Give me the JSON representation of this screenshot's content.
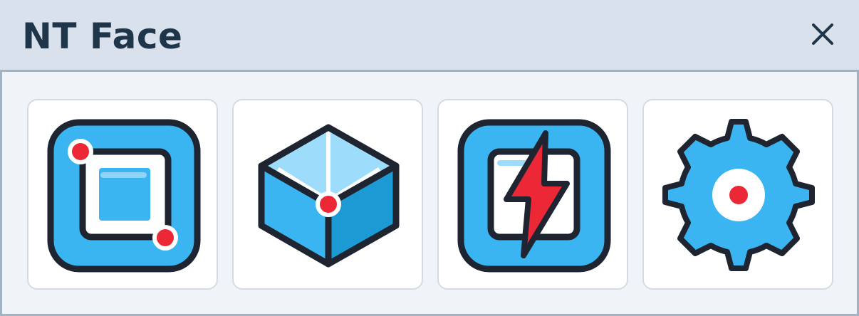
{
  "window": {
    "title": "NT Face",
    "close_icon": "close-icon"
  },
  "toolbar": {
    "tools": [
      {
        "icon": "crop-frame-icon"
      },
      {
        "icon": "box-3d-icon"
      },
      {
        "icon": "flash-icon"
      },
      {
        "icon": "gear-icon"
      }
    ]
  },
  "colors": {
    "titlebar_bg": "#d9e1ec",
    "title_text": "#1f3549",
    "content_bg": "#f0f4f8",
    "icon_blue": "#3bb4f2",
    "icon_outline": "#1e2430",
    "accent_red": "#ed2836"
  }
}
